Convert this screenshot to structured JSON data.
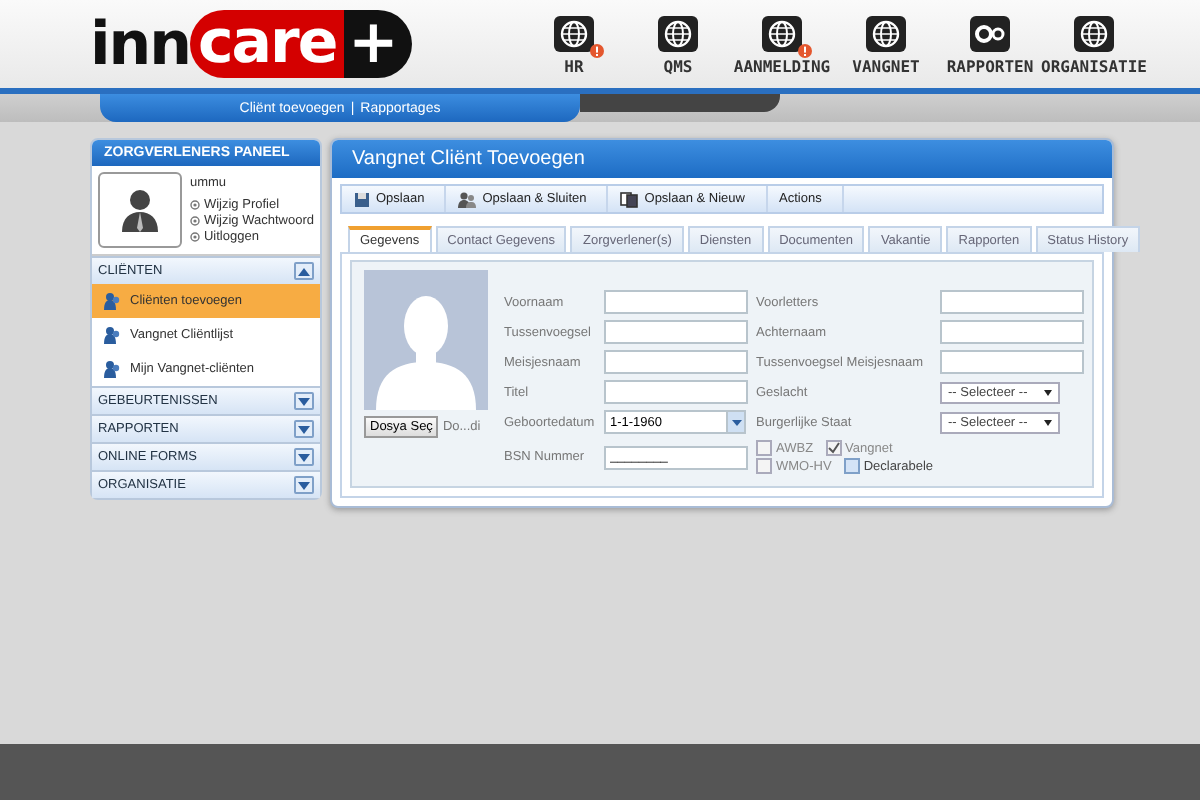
{
  "logo": {
    "dark": "inn",
    "red": "care",
    "plus": "+"
  },
  "nav": [
    {
      "label": "HR",
      "alert": true
    },
    {
      "label": "QMS",
      "alert": false
    },
    {
      "label": "AANMELDING",
      "alert": true
    },
    {
      "label": "VANGNET",
      "alert": false
    },
    {
      "label": "RAPPORTEN",
      "alert": false
    },
    {
      "label": "ORGANISATIE",
      "alert": false
    }
  ],
  "subnav": {
    "links": [
      "Cliënt toevoegen",
      "Rapportages"
    ],
    "separator": "|"
  },
  "panel": {
    "title": "ZORGVERLENERS PANEEL",
    "user": "ummu",
    "links": [
      "Wijzig Profiel",
      "Wijzig Wachtwoord",
      "Uitloggen"
    ],
    "sections": [
      {
        "label": "CLIËNTEN",
        "expanded": true,
        "items": [
          {
            "label": "Cliënten toevoegen",
            "selected": true
          },
          {
            "label": "Vangnet Cliëntlijst",
            "selected": false
          },
          {
            "label": "Mijn Vangnet-cliënten",
            "selected": false
          }
        ]
      },
      {
        "label": "GEBEURTENISSEN",
        "expanded": false
      },
      {
        "label": "RAPPORTEN",
        "expanded": false
      },
      {
        "label": "ONLINE FORMS",
        "expanded": false
      },
      {
        "label": "ORGANISATIE",
        "expanded": false
      }
    ]
  },
  "form": {
    "title": "Vangnet Cliënt Toevoegen",
    "toolbar": [
      {
        "label": "Opslaan"
      },
      {
        "label": "Opslaan & Sluiten"
      },
      {
        "label": "Opslaan & Nieuw"
      },
      {
        "label": "Actions"
      }
    ],
    "tabs": [
      {
        "label": "Gegevens",
        "selected": true
      },
      {
        "label": "Contact Gegevens",
        "selected": false
      },
      {
        "label": "Zorgverlener(s)",
        "selected": false
      },
      {
        "label": "Diensten",
        "selected": false
      },
      {
        "label": "Documenten",
        "selected": false
      },
      {
        "label": "Vakantie",
        "selected": false
      },
      {
        "label": "Rapporten",
        "selected": false
      },
      {
        "label": "Status History",
        "selected": false
      }
    ],
    "file_button": "Dosya Seç",
    "file_name": "Do...di",
    "left_fields": [
      {
        "label": "Voornaam",
        "kind": "text"
      },
      {
        "label": "Tussenvoegsel",
        "kind": "text"
      },
      {
        "label": "Meisjesnaam",
        "kind": "text"
      },
      {
        "label": "Titel",
        "kind": "text"
      },
      {
        "label": "Geboortedatum",
        "kind": "date",
        "value": "1-1-1960"
      }
    ],
    "bsn": {
      "label": "BSN Nummer",
      "value": "________"
    },
    "right_fields": [
      {
        "label": "Voorletters",
        "kind": "text"
      },
      {
        "label": "Achternaam",
        "kind": "text"
      },
      {
        "label": "Tussenvoegsel Meisjesnaam",
        "kind": "text"
      },
      {
        "label": "Geslacht",
        "kind": "select",
        "value": "-- Selecteer --"
      },
      {
        "label": "Burgerlijke Staat",
        "kind": "select",
        "value": "-- Selecteer --"
      }
    ],
    "checkboxes": [
      {
        "label": "AWBZ",
        "checked": false,
        "disabled": true
      },
      {
        "label": "Vangnet",
        "checked": true,
        "disabled": true
      },
      {
        "label": "WMO-HV",
        "checked": false,
        "disabled": true
      },
      {
        "label": "Declarabele",
        "checked": false,
        "disabled": false
      }
    ]
  }
}
